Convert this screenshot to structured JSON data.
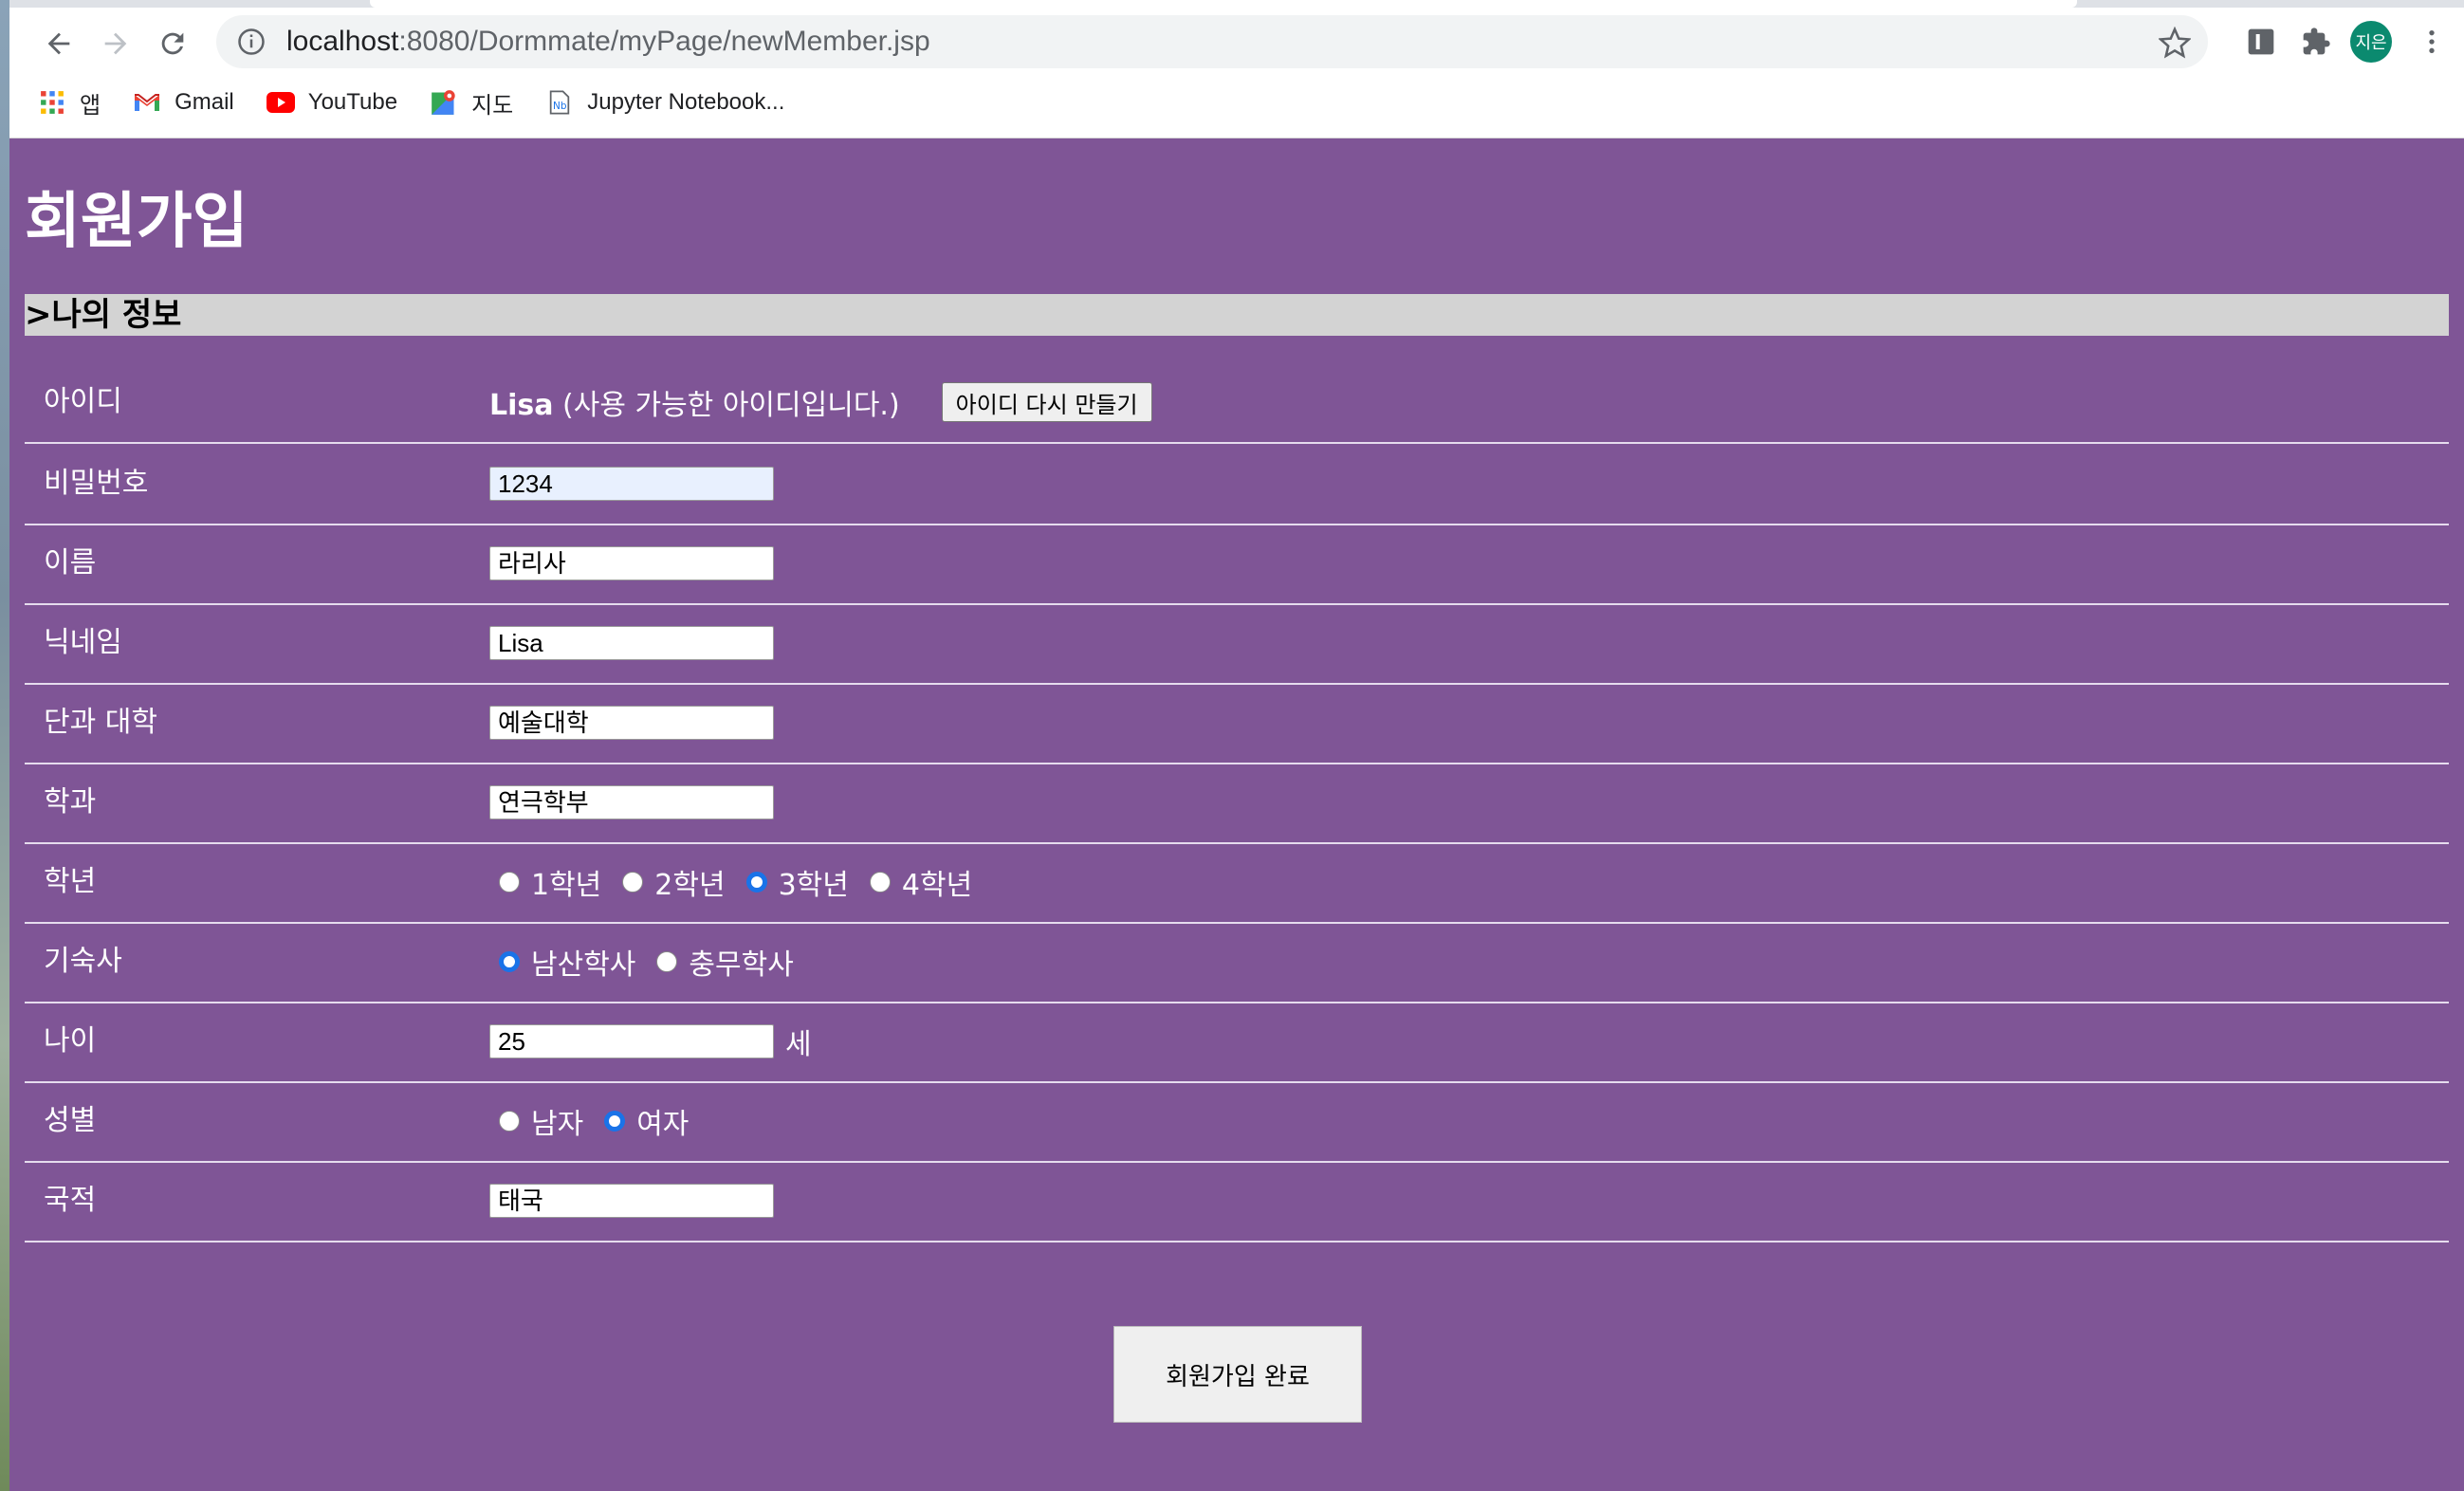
{
  "browser": {
    "url_host": "localhost",
    "url_path": ":8080/Dormmate/myPage/newMember.jsp",
    "avatar_text": "지은",
    "bookmarks": [
      {
        "label": "앱",
        "icon": "apps-grid-icon"
      },
      {
        "label": "Gmail",
        "icon": "gmail-icon"
      },
      {
        "label": "YouTube",
        "icon": "youtube-icon"
      },
      {
        "label": "지도",
        "icon": "maps-icon"
      },
      {
        "label": "Jupyter Notebook...",
        "icon": "jupyter-icon"
      }
    ]
  },
  "page": {
    "title": "회원가입",
    "section": ">나의 정보",
    "fields": {
      "id": {
        "label": "아이디",
        "value": "Lisa",
        "note": "(사용 가능한 아이디입니다.)",
        "button": "아이디 다시 만들기"
      },
      "password": {
        "label": "비밀번호",
        "value": "1234"
      },
      "name": {
        "label": "이름",
        "value": "라리사"
      },
      "nickname": {
        "label": "닉네임",
        "value": "Lisa"
      },
      "college": {
        "label": "단과 대학",
        "value": "예술대학"
      },
      "department": {
        "label": "학과",
        "value": "연극학부"
      },
      "grade": {
        "label": "학년",
        "options": [
          "1학년",
          "2학년",
          "3학년",
          "4학년"
        ],
        "selected": "3학년"
      },
      "dorm": {
        "label": "기숙사",
        "options": [
          "남산학사",
          "충무학사"
        ],
        "selected": "남산학사"
      },
      "age": {
        "label": "나이",
        "value": "25",
        "unit": "세"
      },
      "gender": {
        "label": "성별",
        "options": [
          "남자",
          "여자"
        ],
        "selected": "여자"
      },
      "nationality": {
        "label": "국적",
        "value": "태국"
      }
    },
    "submit": "회원가입 완료"
  },
  "colors": {
    "background": "#7f5596",
    "section_bar": "#d3d3d3",
    "radio_checked": "#1a73e8"
  }
}
